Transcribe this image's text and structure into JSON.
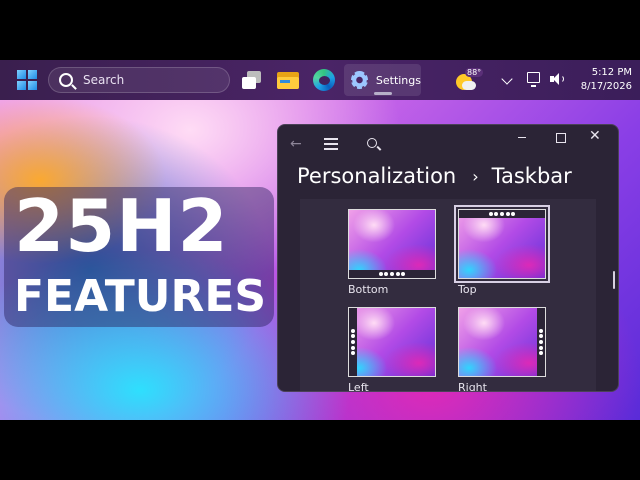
{
  "taskbar": {
    "search_placeholder": "Search",
    "settings_label": "Settings",
    "weather_temp": "88°",
    "time": "5:12 PM",
    "date": "8/17/2026"
  },
  "hero": {
    "title": "25H2",
    "subtitle": "FEATURES"
  },
  "window": {
    "breadcrumb_parent": "Personalization",
    "breadcrumb_separator": "›",
    "breadcrumb_current": "Taskbar",
    "positions": [
      {
        "label": "Bottom"
      },
      {
        "label": "Top",
        "selected": true
      },
      {
        "label": "Left"
      },
      {
        "label": "Right"
      }
    ]
  },
  "icons": [
    "windows-logo-icon",
    "search-icon",
    "task-view-icon",
    "file-explorer-icon",
    "edge-icon",
    "settings-gear-icon",
    "weather-icon",
    "chevron-up-icon",
    "network-icon",
    "volume-icon",
    "back-arrow-icon",
    "hamburger-menu-icon",
    "minimize-icon",
    "maximize-icon",
    "close-icon"
  ]
}
